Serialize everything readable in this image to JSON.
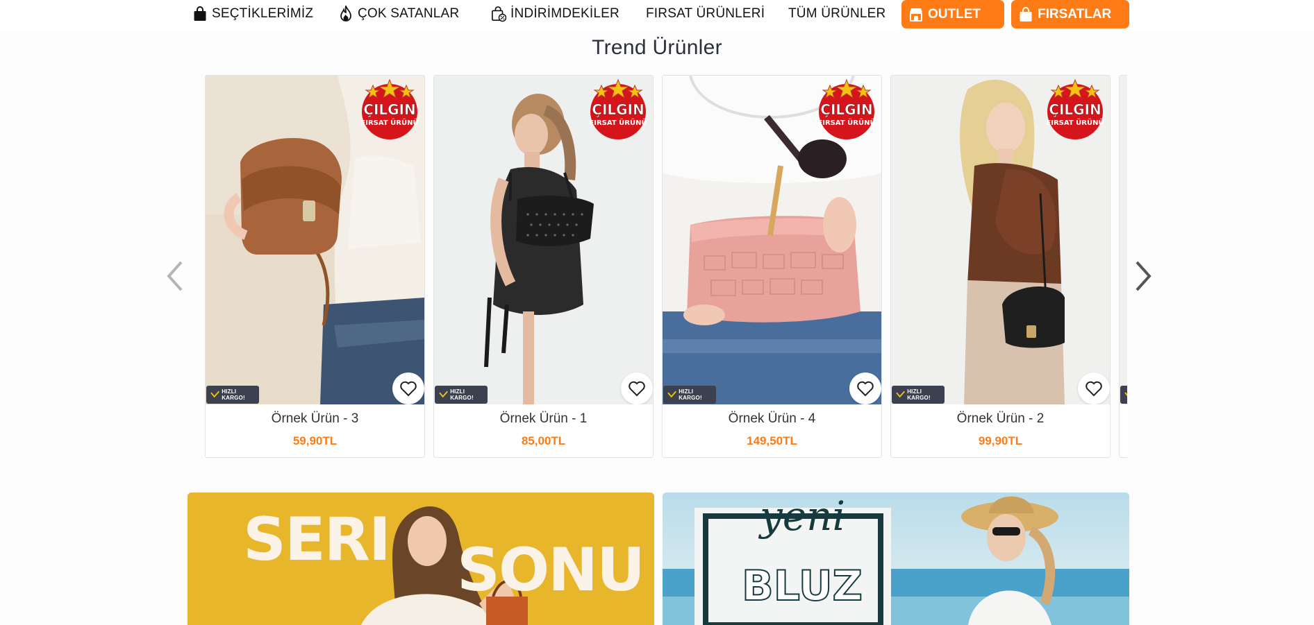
{
  "nav": {
    "items": [
      {
        "label": "SEÇTİKLERİMİZ",
        "icon": "shopping-bag-icon"
      },
      {
        "label": "ÇOK SATANLAR",
        "icon": "flame-icon"
      },
      {
        "label": "İNDİRİMDEKİLER",
        "icon": "discount-bag-icon"
      },
      {
        "label": "FIRSAT ÜRÜNLERİ"
      },
      {
        "label": "TÜM ÜRÜNLER"
      }
    ],
    "buttons": [
      {
        "label": "OUTLET",
        "icon": "store-icon"
      },
      {
        "label": "FIRSATLAR",
        "icon": "gift-bag-icon"
      }
    ]
  },
  "section": {
    "title": "Trend Ürünler"
  },
  "products": [
    {
      "name": "Örnek Ürün - 3",
      "price": "59,90TL",
      "badge": "ÇILGIN",
      "badge_sub": "FIRSAT ÜRÜNÜ",
      "shipping": "HIZLI KARGO!"
    },
    {
      "name": "Örnek Ürün - 1",
      "price": "85,00TL",
      "badge": "ÇILGIN",
      "badge_sub": "FIRSAT ÜRÜNÜ",
      "shipping": "HIZLI KARGO!"
    },
    {
      "name": "Örnek Ürün - 4",
      "price": "149,50TL",
      "badge": "ÇILGIN",
      "badge_sub": "FIRSAT ÜRÜNÜ",
      "shipping": "HIZLI KARGO!"
    },
    {
      "name": "Örnek Ürün - 2",
      "price": "99,90TL",
      "badge": "ÇILGIN",
      "badge_sub": "FIRSAT ÜRÜNÜ",
      "shipping": "HIZLI KARGO!"
    }
  ],
  "banners": {
    "left": {
      "word1": "SERI",
      "word2": "SONU"
    },
    "right": {
      "word1": "yeni",
      "word2": "BLUZ"
    }
  },
  "colors": {
    "accent": "#ff7b16",
    "badge_red": "#d4151b",
    "title": "#2b2f3a"
  }
}
